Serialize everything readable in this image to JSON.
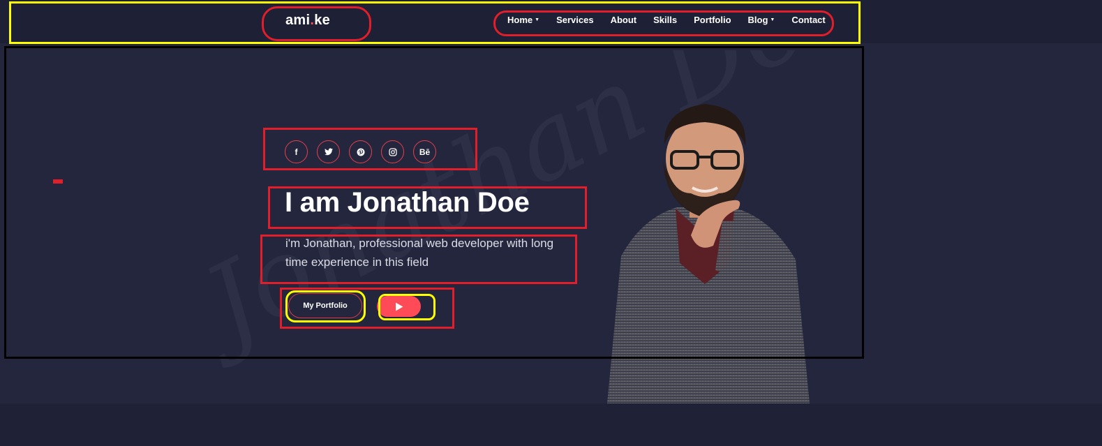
{
  "header": {
    "logo": {
      "prefix": "ami",
      "dot": ".",
      "suffix": "ke"
    },
    "nav": [
      {
        "label": "Home",
        "dropdown": true
      },
      {
        "label": "Services",
        "dropdown": false
      },
      {
        "label": "About",
        "dropdown": false
      },
      {
        "label": "Skills",
        "dropdown": false
      },
      {
        "label": "Portfolio",
        "dropdown": false
      },
      {
        "label": "Blog",
        "dropdown": true
      },
      {
        "label": "Contact",
        "dropdown": false
      }
    ]
  },
  "hero": {
    "watermark_text": "Jonathan Doe",
    "social": [
      {
        "icon": "facebook-icon",
        "glyph": "f"
      },
      {
        "icon": "twitter-icon",
        "glyph": "t"
      },
      {
        "icon": "pinterest-icon",
        "glyph": "p"
      },
      {
        "icon": "instagram-icon",
        "glyph": "i"
      },
      {
        "icon": "behance-icon",
        "glyph": "Bē"
      }
    ],
    "title": "I am Jonathan Doe",
    "subtitle": "i'm Jonathan, professional web developer with long time experience in this field",
    "portfolio_button": "My Portfolio",
    "play_button_icon": "play-icon"
  },
  "colors": {
    "accent": "#ff4a57",
    "background": "#23263d",
    "header_background": "#1e2135",
    "annotation_red": "#e11e2a",
    "annotation_yellow": "#ffff00",
    "annotation_black": "#000000"
  }
}
